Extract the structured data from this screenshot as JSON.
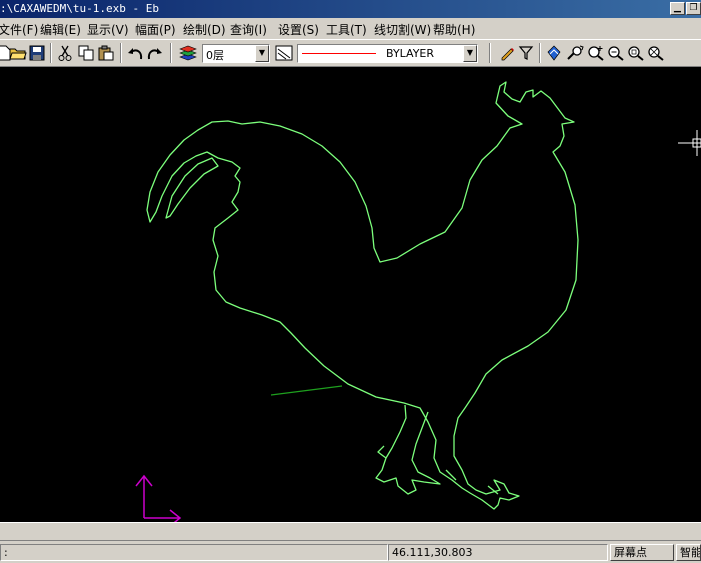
{
  "window": {
    "title": ":\\CAXAWEDM\\tu-1.exb - Eb"
  },
  "menu": [
    {
      "label": "文件(F)",
      "name": "menu-file"
    },
    {
      "label": "编辑(E)",
      "name": "menu-edit"
    },
    {
      "label": "显示(V)",
      "name": "menu-view"
    },
    {
      "label": "幅面(P)",
      "name": "menu-sheet"
    },
    {
      "label": "绘制(D)",
      "name": "menu-draw"
    },
    {
      "label": "查询(I)",
      "name": "menu-query"
    },
    {
      "label": "设置(S)",
      "name": "menu-settings"
    },
    {
      "label": "工具(T)",
      "name": "menu-tools"
    },
    {
      "label": "线切割(W)",
      "name": "menu-wirecut"
    },
    {
      "label": "帮助(H)",
      "name": "menu-help"
    }
  ],
  "toolbar": {
    "layer_value": "0层",
    "linetype_value": "BYLAYER",
    "linetype_color": "#ff0000"
  },
  "colors": {
    "drawing_line": "#7cff7c",
    "axis_color": "#cc00cc",
    "canvas_bg": "#000000"
  },
  "status": {
    "prompt": ":",
    "coordinates": "46.111,30.803",
    "snap_mode": "屏幕点",
    "smart": "智能"
  }
}
